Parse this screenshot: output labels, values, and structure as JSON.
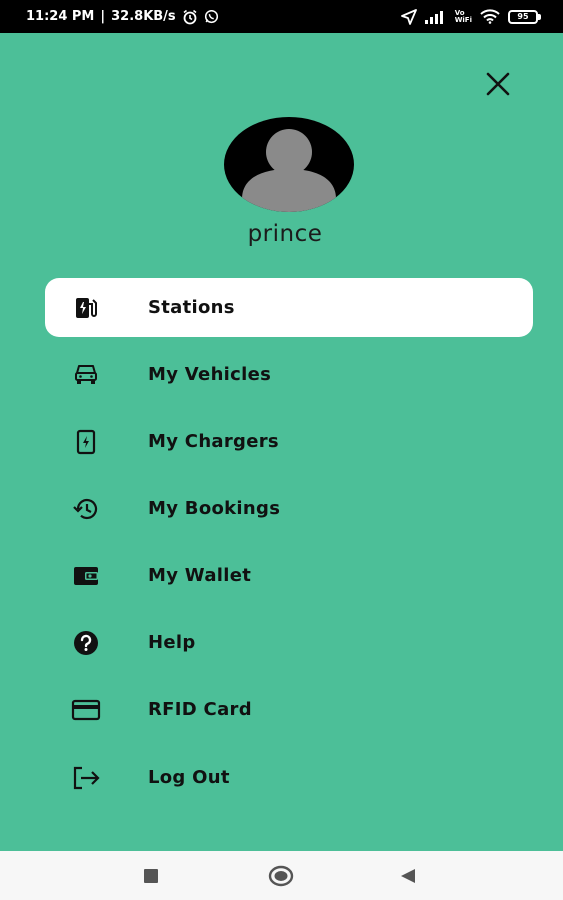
{
  "status_bar": {
    "time": "11:24 PM",
    "speed": "32.8KB/s",
    "battery": "95",
    "network_label_top": "Vo",
    "network_label_bottom": "WiFi"
  },
  "drawer": {
    "username": "prince",
    "close_icon": "close-icon",
    "accent_color": "#4cbf98",
    "items": [
      {
        "label": "Stations",
        "icon": "ev-station-icon",
        "active": true
      },
      {
        "label": "My Vehicles",
        "icon": "car-icon",
        "active": false
      },
      {
        "label": "My Chargers",
        "icon": "charger-icon",
        "active": false
      },
      {
        "label": "My Bookings",
        "icon": "history-icon",
        "active": false
      },
      {
        "label": "My Wallet",
        "icon": "wallet-icon",
        "active": false
      },
      {
        "label": "Help",
        "icon": "help-icon",
        "active": false
      },
      {
        "label": "RFID Card",
        "icon": "card-icon",
        "active": false
      },
      {
        "label": "Log Out",
        "icon": "logout-icon",
        "active": false
      }
    ]
  },
  "nav_bar": {
    "recents": "recents-icon",
    "home": "home-icon",
    "back": "back-icon"
  }
}
